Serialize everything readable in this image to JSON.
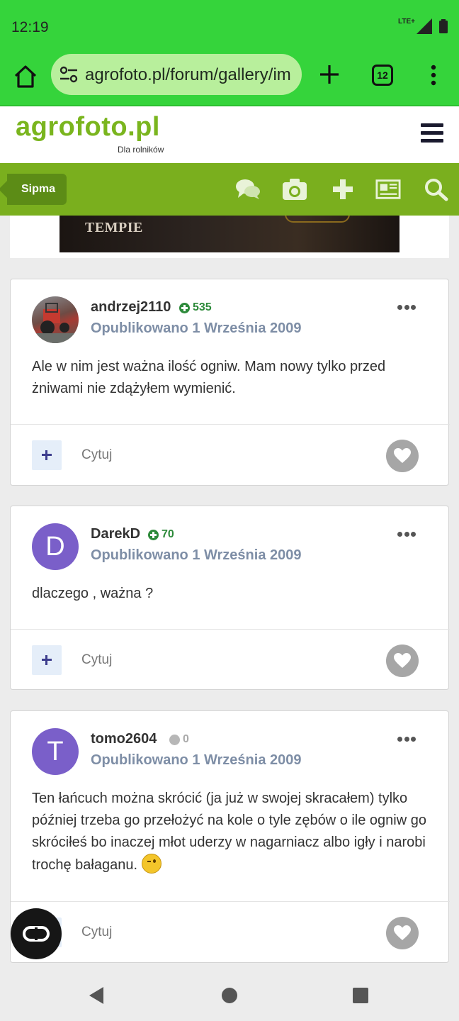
{
  "status_bar": {
    "time": "12:19",
    "network": "LTE+"
  },
  "browser": {
    "url": "agrofoto.pl/forum/gallery/im",
    "tab_count": "12"
  },
  "site": {
    "logo": "agrofoto.pl",
    "tagline": "Dla rolników"
  },
  "nav": {
    "user_tag": "Sipma"
  },
  "ad": {
    "text_line": "TEMPIE"
  },
  "posts": [
    {
      "author": "andrzej2110",
      "reputation": "535",
      "date": "Opublikowano 1 Września 2009",
      "body": "Ale w nim jest ważna ilość ogniw. Mam nowy tylko przed żniwami nie zdążyłem wymienić.",
      "cite_label": "Cytuj"
    },
    {
      "author": "DarekD",
      "avatar_letter": "D",
      "reputation": "70",
      "date": "Opublikowano 1 Września 2009",
      "body": "dlaczego , ważna ?",
      "cite_label": "Cytuj"
    },
    {
      "author": "tomo2604",
      "avatar_letter": "T",
      "reputation": "0",
      "date": "Opublikowano 1 Września 2009",
      "body": "Ten łańcuch można skrócić (ja już w swojej skracałem) tylko później trzeba go przełożyć na kole o tyle zębów o ile ogniw go skróciłeś bo inaczej młot uderzy w nagarniacz albo igły i narobi trochę bałaganu.",
      "cite_label": "Cytuj"
    }
  ],
  "colors": {
    "browser_green": "#35d43b",
    "site_green": "#7aaf1e",
    "avatar_purple": "#7a5fc9",
    "rep_green": "#2d8a3a"
  }
}
